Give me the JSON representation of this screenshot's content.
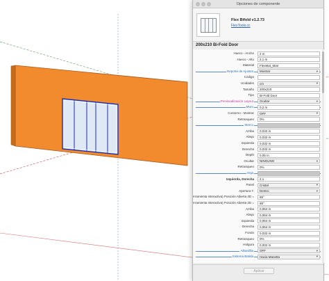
{
  "window": {
    "title": "Opciones de componente"
  },
  "plugin": {
    "name": "Flex Bifold v1.2.73",
    "link": "FlexTools.cc"
  },
  "component": {
    "title": "200x210 Bi-Fold Door"
  },
  "rows": [
    {
      "label": "Hueco - Ancho",
      "value": "2 m",
      "type": "input"
    },
    {
      "label": "Hueco - Alto",
      "value": "2,1 m",
      "type": "input"
    },
    {
      "label": "Material",
      "value": "FlexMat_Marr",
      "type": "input"
    },
    {
      "label": "Reporte de Ajustes",
      "value": "Mostrar",
      "type": "select",
      "section": true
    },
    {
      "label": "Código",
      "value": "",
      "type": "input"
    },
    {
      "label": "Unidades",
      "value": "cm",
      "type": "select"
    },
    {
      "label": "Tamaño",
      "value": "200x210",
      "type": "input"
    },
    {
      "label": "Tipo",
      "value": "Bi-Fold Door",
      "type": "input"
    },
    {
      "label": "Previsualización Layout",
      "value": "Ocultar",
      "type": "select",
      "section": true,
      "pink": true
    },
    {
      "label": "Muro",
      "value": "0,2 m",
      "type": "input",
      "section": true
    },
    {
      "label": "Contorno - Mostrar",
      "value": "OFF",
      "type": "select"
    },
    {
      "label": "Retranqueo",
      "value": "0%",
      "type": "input"
    },
    {
      "label": "Marco",
      "value": "",
      "type": "disabled",
      "section": true
    },
    {
      "label": "Arriba",
      "value": "0,032 m",
      "type": "input"
    },
    {
      "label": "Abajo",
      "value": "0,032 m",
      "type": "input"
    },
    {
      "label": "Izquierda",
      "value": "0,032 m",
      "type": "input"
    },
    {
      "label": "Derecha",
      "value": "0,032 m",
      "type": "input"
    },
    {
      "label": "Depth",
      "value": "0,05 m",
      "type": "input"
    },
    {
      "label": "Ocultar",
      "value": "NINGUNO",
      "type": "select"
    },
    {
      "label": "Retranqueo",
      "value": "0%",
      "type": "input"
    },
    {
      "label": "Hoja",
      "value": "",
      "type": "disabled",
      "section": true
    },
    {
      "label": "Izquierda, Derecha",
      "value": "2,1",
      "type": "input",
      "bold": true
    },
    {
      "label": "Panel",
      "value": "Cristal",
      "type": "select"
    },
    {
      "label": "Apertura T.",
      "value": "Dentro",
      "type": "select"
    },
    {
      "label": "(herramienta interactiva) Posición Abierta 3D =",
      "value": "85°",
      "type": "input"
    },
    {
      "label": "(herramienta interactiva) Posición Abierta 2D =",
      "value": "85°",
      "type": "input"
    },
    {
      "label": "Arriba",
      "value": "0,064 m",
      "type": "input"
    },
    {
      "label": "Abajo",
      "value": "0,064 m",
      "type": "input"
    },
    {
      "label": "Izquierda",
      "value": "0,064 m",
      "type": "input"
    },
    {
      "label": "Derecha",
      "value": "0,064 m",
      "type": "input"
    },
    {
      "label": "Fondo",
      "value": "0,032 m",
      "type": "input"
    },
    {
      "label": "Retranqueo",
      "value": "0%",
      "type": "input"
    },
    {
      "label": "Holgura",
      "value": "0,002 m",
      "type": "input"
    },
    {
      "label": "Albardilla",
      "value": "OFF",
      "type": "select",
      "section": true
    },
    {
      "label": "Sistema Batida",
      "value": "Hacia Manetta",
      "type": "select",
      "section": true
    }
  ],
  "footer": {
    "apply_label": "Aplicar"
  },
  "colors": {
    "wall": "#f28a2e",
    "section_line": "#5d8bc9",
    "pink_label": "#c0339c",
    "link": "#2a5db0"
  }
}
